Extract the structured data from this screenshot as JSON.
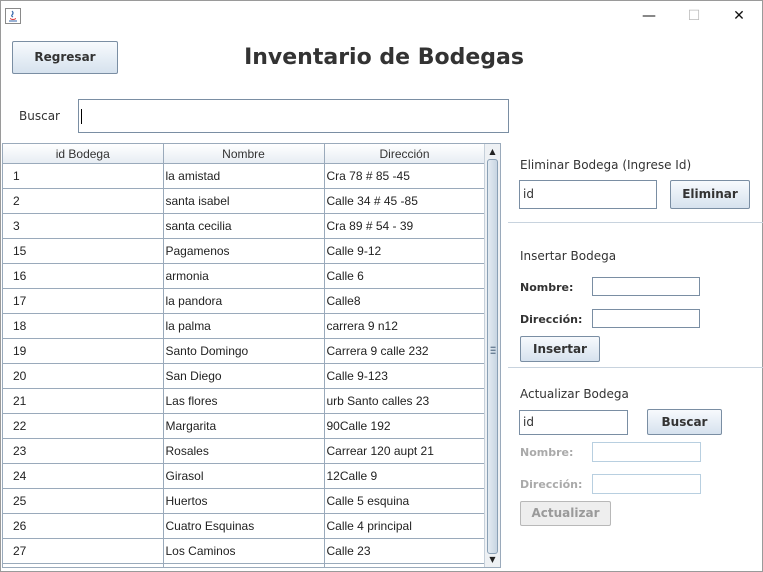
{
  "window": {
    "close_glyph": "✕",
    "minimize_glyph": "—",
    "maximize_glyph": "☐"
  },
  "header": {
    "back_label": "Regresar",
    "title": "Inventario de Bodegas"
  },
  "search": {
    "label": "Buscar",
    "value": ""
  },
  "table": {
    "columns": [
      "id Bodega",
      "Nombre",
      "Dirección"
    ],
    "rows": [
      [
        "1",
        "la amistad",
        "Cra 78 # 85 -45"
      ],
      [
        "2",
        "santa isabel",
        "Calle 34 # 45 -85"
      ],
      [
        "3",
        "santa cecilia",
        "Cra 89 # 54 - 39"
      ],
      [
        "15",
        "Pagamenos",
        "Calle 9-12"
      ],
      [
        "16",
        "armonia",
        "Calle 6"
      ],
      [
        "17",
        "la pandora",
        "Calle8"
      ],
      [
        "18",
        "la palma",
        "carrera 9 n12"
      ],
      [
        "19",
        "Santo Domingo",
        "Carrera 9 calle 232"
      ],
      [
        "20",
        "San Diego",
        "Calle 9-123"
      ],
      [
        "21",
        "Las flores",
        "urb Santo calles 23"
      ],
      [
        "22",
        "Margarita",
        "90Calle 192"
      ],
      [
        "23",
        "Rosales",
        "Carrear 120 aupt 21"
      ],
      [
        "24",
        "Girasol",
        "12Calle 9"
      ],
      [
        "25",
        "Huertos",
        "Calle 5 esquina"
      ],
      [
        "26",
        "Cuatro Esquinas",
        "Calle 4 principal"
      ],
      [
        "27",
        "Los Caminos",
        "Calle 23"
      ],
      [
        "",
        "",
        ""
      ]
    ]
  },
  "delete_panel": {
    "title": "Eliminar Bodega (Ingrese Id)",
    "id_value": "id",
    "button_label": "Eliminar"
  },
  "insert_panel": {
    "title": "Insertar Bodega",
    "name_label": "Nombre:",
    "address_label": "Dirección:",
    "name_value": "",
    "address_value": "",
    "button_label": "Insertar"
  },
  "update_panel": {
    "title": "Actualizar Bodega",
    "id_value": "id",
    "search_label": "Buscar",
    "name_label": "Nombre:",
    "address_label": "Dirección:",
    "name_value": "",
    "address_value": "",
    "button_label": "Actualizar"
  }
}
